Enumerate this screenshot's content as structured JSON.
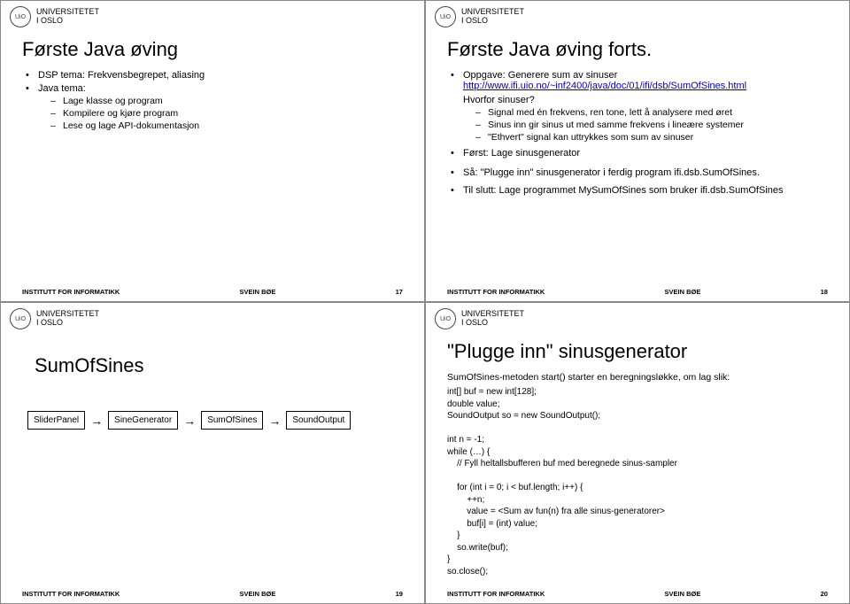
{
  "uni": {
    "line1": "UNIVERSITETET",
    "line2": "I OSLO",
    "seal": "UiO"
  },
  "footer": {
    "left": "INSTITUTT FOR INFORMATIKK",
    "mid": "SVEIN BØE"
  },
  "slide17": {
    "title": "Første Java øving",
    "b1_1": "DSP tema: Frekvensbegrepet, aliasing",
    "b1_2": "Java tema:",
    "b2_1": "Lage klasse og program",
    "b2_2": "Kompilere og kjøre program",
    "b2_3": "Lese og lage API-dokumentasjon",
    "page": "17"
  },
  "slide18": {
    "title": "Første Java øving forts.",
    "b1_1a": "Oppgave: Generere sum av sinuser",
    "link": "http://www.ifi.uio.no/~inf2400/java/doc/01/ifi/dsb/SumOfSines.html",
    "q": "Hvorfor sinuser?",
    "b2_1": "Signal med én frekvens, ren tone, lett å analysere med øret",
    "b2_2": "Sinus inn gir sinus ut med samme frekvens i lineære systemer",
    "b2_3": "\"Ethvert\" signal kan uttrykkes som sum av sinuser",
    "b1_2": "Først: Lage sinusgenerator",
    "b1_3": "Så: \"Plugge inn\" sinusgenerator i ferdig program ifi.dsb.SumOfSines.",
    "b1_4": "Til slutt: Lage programmet MySumOfSines som bruker ifi.dsb.SumOfSines",
    "page": "18"
  },
  "slide19": {
    "title": "SumOfSines",
    "box1": "SliderPanel",
    "box2": "SineGenerator",
    "box3": "SumOfSines",
    "box4": "SoundOutput",
    "page": "19"
  },
  "slide20": {
    "title": "\"Plugge inn\" sinusgenerator",
    "sub": "SumOfSines-metoden start() starter en beregningsløkke, om lag slik:",
    "code": "int[] buf = new int[128];\ndouble value;\nSoundOutput so = new SoundOutput();\n\nint n = -1;\nwhile (…) {\n    // Fyll heltallsbufferen buf med beregnede sinus-sampler\n\n    for (int i = 0; i < buf.length; i++) {\n        ++n;\n        value = <Sum av fun(n) fra alle sinus-generatorer>\n        buf[i] = (int) value;\n    }\n    so.write(buf);\n}\nso.close();",
    "page": "20"
  }
}
